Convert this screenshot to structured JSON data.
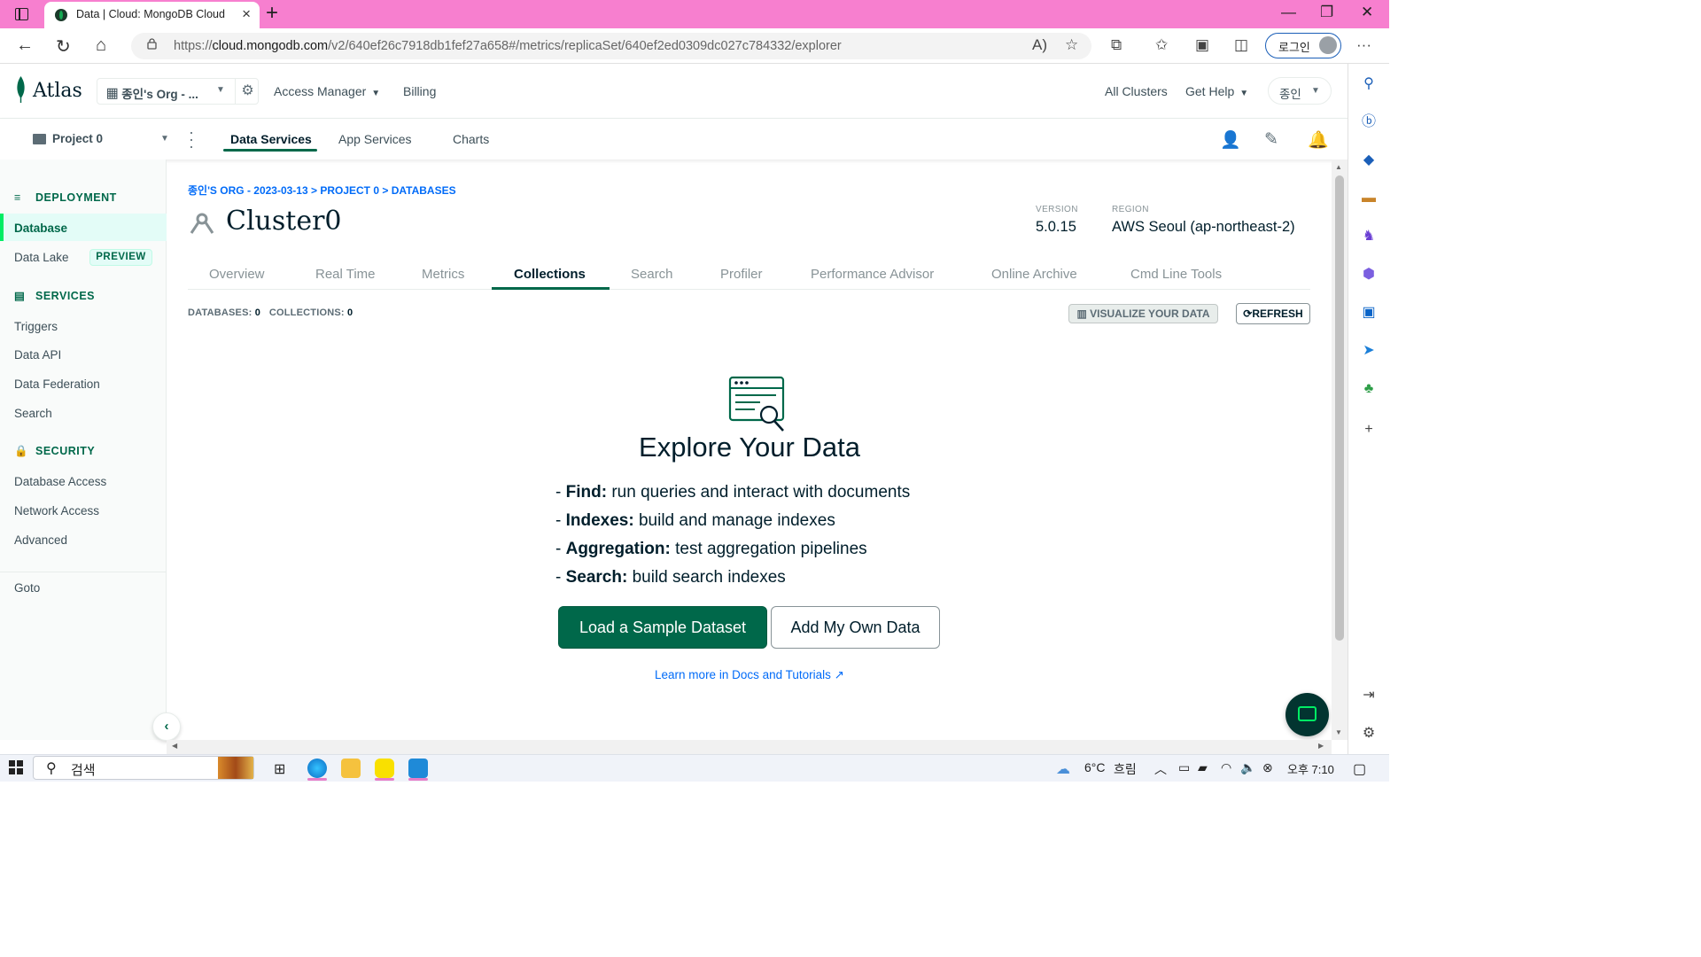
{
  "browser": {
    "tab_title": "Data | Cloud: MongoDB Cloud",
    "url_prefix": "https://",
    "url_host": "cloud.mongodb.com",
    "url_path": "/v2/640ef26c7918db1fef27a658#/metrics/replicaSet/640ef2ed0309dc027c784332/explorer",
    "login_label": "로그인"
  },
  "header": {
    "brand": "Atlas",
    "org_name": "종인's Org - ...",
    "access_manager": "Access Manager",
    "billing": "Billing",
    "all_clusters": "All Clusters",
    "get_help": "Get Help",
    "user": "종인"
  },
  "project_bar": {
    "project": "Project 0",
    "tabs": [
      {
        "label": "Data Services",
        "active": true
      },
      {
        "label": "App Services",
        "active": false
      },
      {
        "label": "Charts",
        "active": false
      }
    ]
  },
  "sidebar": {
    "deployment": "DEPLOYMENT",
    "database": "Database",
    "data_lake": "Data Lake",
    "preview": "PREVIEW",
    "services": "SERVICES",
    "triggers": "Triggers",
    "data_api": "Data API",
    "data_federation": "Data Federation",
    "search": "Search",
    "security": "SECURITY",
    "database_access": "Database Access",
    "network_access": "Network Access",
    "advanced": "Advanced",
    "goto": "Goto"
  },
  "main": {
    "breadcrumb": "종인'S ORG - 2023-03-13 > PROJECT 0 > DATABASES",
    "cluster_name": "Cluster0",
    "version_label": "VERSION",
    "version_value": "5.0.15",
    "region_label": "REGION",
    "region_value": "AWS Seoul (ap-northeast-2)",
    "tabs": {
      "overview": "Overview",
      "real_time": "Real Time",
      "metrics": "Metrics",
      "collections": "Collections",
      "search": "Search",
      "profiler": "Profiler",
      "performance_advisor": "Performance Advisor",
      "online_archive": "Online Archive",
      "cmd_line_tools": "Cmd Line Tools"
    },
    "databases_label": "DATABASES:",
    "databases_count": "0",
    "collections_label": "COLLECTIONS:",
    "collections_count": "0",
    "visualize_btn": "VISUALIZE YOUR DATA",
    "refresh_btn": "REFRESH",
    "explore_title": "Explore Your Data",
    "features": [
      {
        "prefix": "- ",
        "term": "Find:",
        "desc": " run queries and interact with documents"
      },
      {
        "prefix": "- ",
        "term": "Indexes:",
        "desc": " build and manage indexes"
      },
      {
        "prefix": "- ",
        "term": "Aggregation:",
        "desc": " test aggregation pipelines"
      },
      {
        "prefix": "- ",
        "term": "Search:",
        "desc": " build search indexes"
      }
    ],
    "load_sample_btn": "Load a Sample Dataset",
    "add_own_btn": "Add My Own Data",
    "learn_more": "Learn more in Docs and Tutorials"
  },
  "taskbar": {
    "search_placeholder": "검색",
    "weather": "6°C",
    "weather_desc": "흐림",
    "time": "오후 7:10"
  },
  "colors": {
    "brand_green": "#00684a",
    "accent_green": "#00ed64",
    "link_blue": "#016bf8",
    "browser_chrome": "#f77fcf"
  }
}
